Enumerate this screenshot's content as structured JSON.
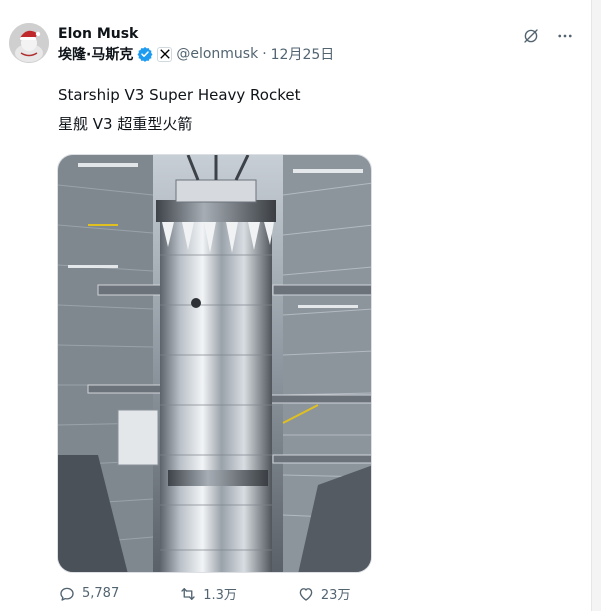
{
  "author": {
    "display_name": "Elon Musk",
    "alt_name": "埃隆·马斯克",
    "handle": "@elonmusk",
    "separator": "·",
    "timestamp": "12月25日",
    "verified": true,
    "affiliation_badge": "x-logo-icon"
  },
  "post": {
    "text_en": "Starship V3 Super Heavy Rocket",
    "text_cn": "星舰 V3 超重型火箭"
  },
  "actions": {
    "replies": "5,787",
    "reposts": "1.3万",
    "likes": "23万"
  },
  "colors": {
    "verified_blue": "#1d9bf0",
    "secondary_text": "#536471",
    "primary_text": "#0f1419"
  },
  "icons": [
    "grok-icon",
    "more-icon",
    "reply-icon",
    "repost-icon",
    "like-icon",
    "verified-icon"
  ]
}
